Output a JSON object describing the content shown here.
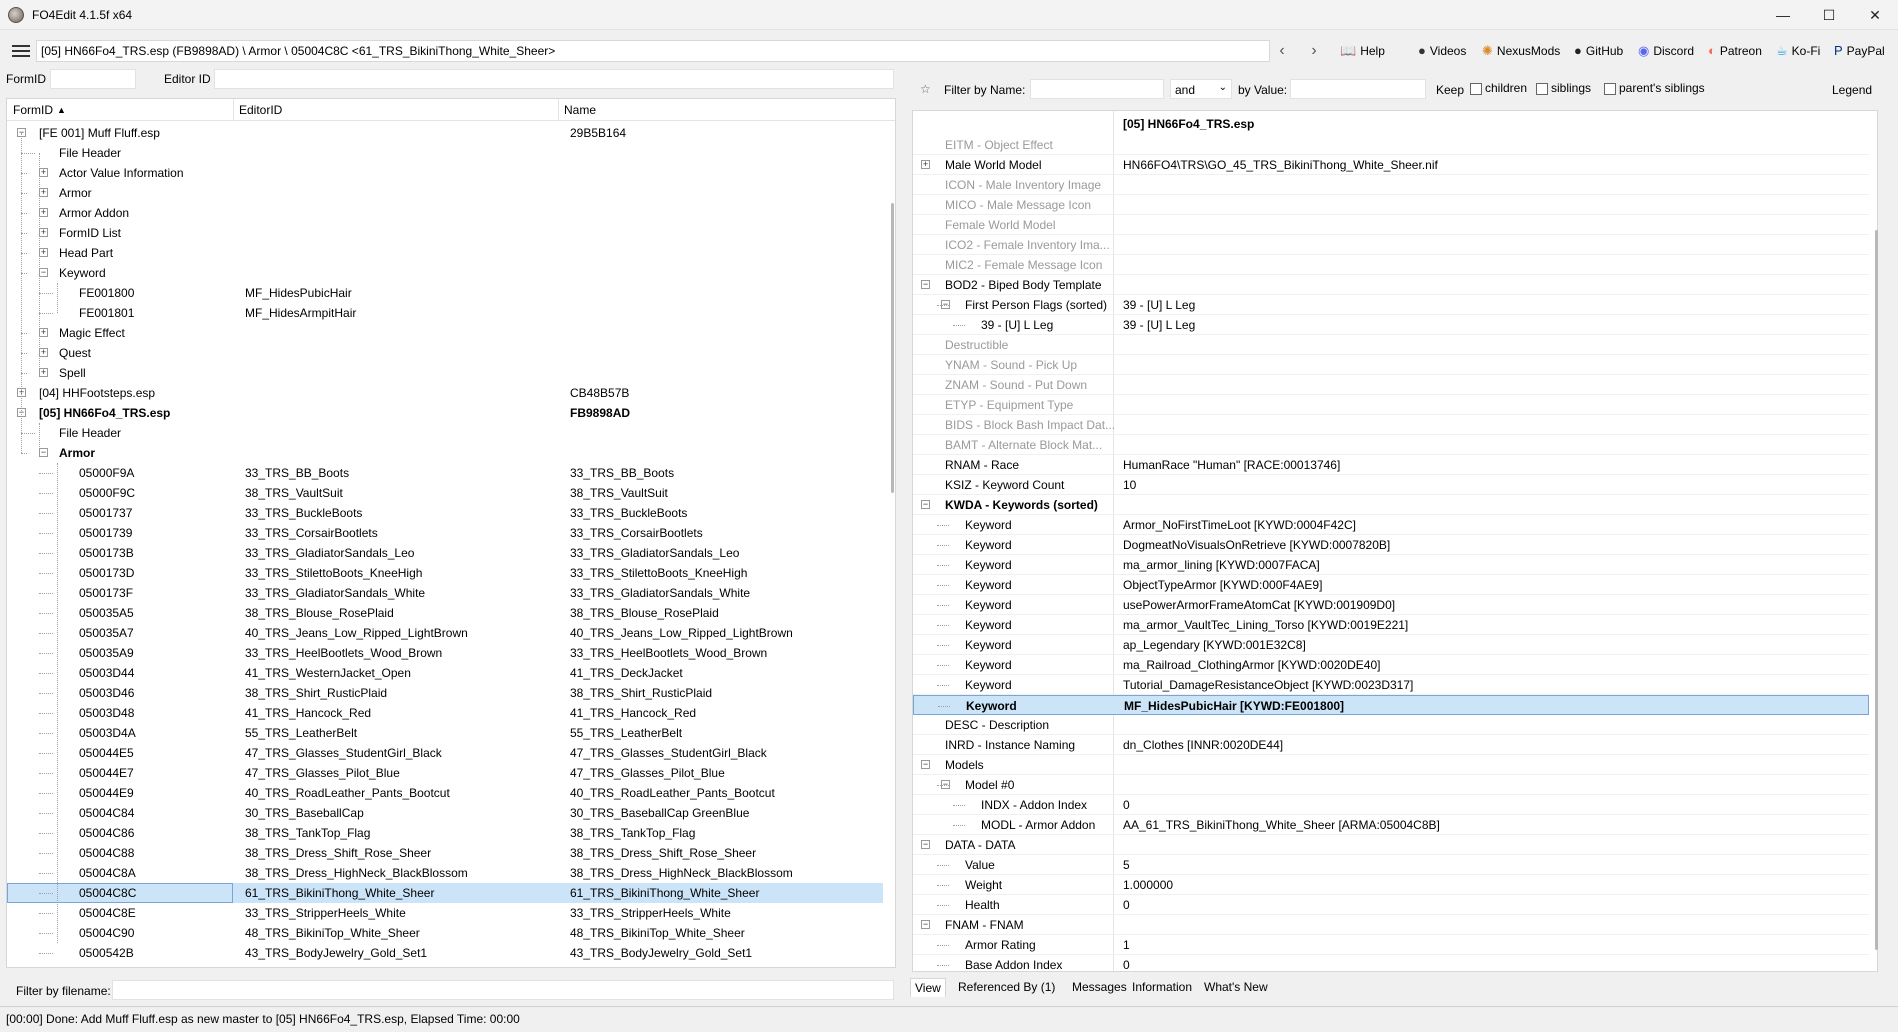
{
  "window": {
    "title": "FO4Edit 4.1.5f x64",
    "minimize": "—",
    "maximize": "☐",
    "close": "✕"
  },
  "pathbar": {
    "path": "[05] HN66Fo4_TRS.esp (FB9898AD) \\ Armor \\ 05004C8C <61_TRS_BikiniThong_White_Sheer>"
  },
  "links": [
    {
      "label": "Help",
      "icon": "book-icon"
    },
    {
      "label": "Videos",
      "icon": "video-icon"
    },
    {
      "label": "NexusMods",
      "icon": "nexus-icon"
    },
    {
      "label": "GitHub",
      "icon": "github-icon"
    },
    {
      "label": "Discord",
      "icon": "discord-icon"
    },
    {
      "label": "Patreon",
      "icon": "patreon-icon"
    },
    {
      "label": "Ko-Fi",
      "icon": "kofi-icon"
    },
    {
      "label": "PayPal",
      "icon": "paypal-icon"
    }
  ],
  "left": {
    "formid_label": "FormID",
    "editorid_label": "Editor ID",
    "columns": [
      "FormID",
      "EditorID",
      "Name"
    ],
    "filter_label": "Filter by filename:",
    "rows": [
      {
        "depth": 0,
        "exp": "−",
        "c1": "[FE 001] Muff Fluff.esp",
        "c2": "",
        "c3": "29B5B164",
        "bold": false
      },
      {
        "depth": 1,
        "exp": "",
        "c1": "File Header",
        "c2": "",
        "c3": ""
      },
      {
        "depth": 1,
        "exp": "+",
        "c1": "Actor Value Information",
        "c2": "",
        "c3": ""
      },
      {
        "depth": 1,
        "exp": "+",
        "c1": "Armor",
        "c2": "",
        "c3": ""
      },
      {
        "depth": 1,
        "exp": "+",
        "c1": "Armor Addon",
        "c2": "",
        "c3": ""
      },
      {
        "depth": 1,
        "exp": "+",
        "c1": "FormID List",
        "c2": "",
        "c3": ""
      },
      {
        "depth": 1,
        "exp": "+",
        "c1": "Head Part",
        "c2": "",
        "c3": ""
      },
      {
        "depth": 1,
        "exp": "−",
        "c1": "Keyword",
        "c2": "",
        "c3": ""
      },
      {
        "depth": 2,
        "exp": "",
        "c1": "FE001800",
        "c2": "MF_HidesPubicHair",
        "c3": ""
      },
      {
        "depth": 2,
        "exp": "",
        "c1": "FE001801",
        "c2": "MF_HidesArmpitHair",
        "c3": ""
      },
      {
        "depth": 1,
        "exp": "+",
        "c1": "Magic Effect",
        "c2": "",
        "c3": ""
      },
      {
        "depth": 1,
        "exp": "+",
        "c1": "Quest",
        "c2": "",
        "c3": ""
      },
      {
        "depth": 1,
        "exp": "+",
        "c1": "Spell",
        "c2": "",
        "c3": ""
      },
      {
        "depth": 0,
        "exp": "+",
        "c1": "[04] HHFootsteps.esp",
        "c2": "",
        "c3": "CB48B57B"
      },
      {
        "depth": 0,
        "exp": "−",
        "c1": "[05] HN66Fo4_TRS.esp",
        "c2": "",
        "c3": "FB9898AD",
        "bold": true
      },
      {
        "depth": 1,
        "exp": "",
        "c1": "File Header",
        "c2": "",
        "c3": ""
      },
      {
        "depth": 1,
        "exp": "−",
        "c1": "Armor",
        "c2": "",
        "c3": "",
        "bold": true
      },
      {
        "depth": 2,
        "exp": "",
        "c1": "05000F9A",
        "c2": "33_TRS_BB_Boots",
        "c3": "33_TRS_BB_Boots"
      },
      {
        "depth": 2,
        "exp": "",
        "c1": "05000F9C",
        "c2": "38_TRS_VaultSuit",
        "c3": "38_TRS_VaultSuit"
      },
      {
        "depth": 2,
        "exp": "",
        "c1": "05001737",
        "c2": "33_TRS_BuckleBoots",
        "c3": "33_TRS_BuckleBoots"
      },
      {
        "depth": 2,
        "exp": "",
        "c1": "05001739",
        "c2": "33_TRS_CorsairBootlets",
        "c3": "33_TRS_CorsairBootlets"
      },
      {
        "depth": 2,
        "exp": "",
        "c1": "0500173B",
        "c2": "33_TRS_GladiatorSandals_Leo",
        "c3": "33_TRS_GladiatorSandals_Leo"
      },
      {
        "depth": 2,
        "exp": "",
        "c1": "0500173D",
        "c2": "33_TRS_StilettoBoots_KneeHigh",
        "c3": "33_TRS_StilettoBoots_KneeHigh"
      },
      {
        "depth": 2,
        "exp": "",
        "c1": "0500173F",
        "c2": "33_TRS_GladiatorSandals_White",
        "c3": "33_TRS_GladiatorSandals_White"
      },
      {
        "depth": 2,
        "exp": "",
        "c1": "050035A5",
        "c2": "38_TRS_Blouse_RosePlaid",
        "c3": "38_TRS_Blouse_RosePlaid"
      },
      {
        "depth": 2,
        "exp": "",
        "c1": "050035A7",
        "c2": "40_TRS_Jeans_Low_Ripped_LightBrown",
        "c3": "40_TRS_Jeans_Low_Ripped_LightBrown"
      },
      {
        "depth": 2,
        "exp": "",
        "c1": "050035A9",
        "c2": "33_TRS_HeelBootlets_Wood_Brown",
        "c3": "33_TRS_HeelBootlets_Wood_Brown"
      },
      {
        "depth": 2,
        "exp": "",
        "c1": "05003D44",
        "c2": "41_TRS_WesternJacket_Open",
        "c3": "41_TRS_DeckJacket"
      },
      {
        "depth": 2,
        "exp": "",
        "c1": "05003D46",
        "c2": "38_TRS_Shirt_RusticPlaid",
        "c3": "38_TRS_Shirt_RusticPlaid"
      },
      {
        "depth": 2,
        "exp": "",
        "c1": "05003D48",
        "c2": "41_TRS_Hancock_Red",
        "c3": "41_TRS_Hancock_Red"
      },
      {
        "depth": 2,
        "exp": "",
        "c1": "05003D4A",
        "c2": "55_TRS_LeatherBelt",
        "c3": "55_TRS_LeatherBelt"
      },
      {
        "depth": 2,
        "exp": "",
        "c1": "050044E5",
        "c2": "47_TRS_Glasses_StudentGirl_Black",
        "c3": "47_TRS_Glasses_StudentGirl_Black"
      },
      {
        "depth": 2,
        "exp": "",
        "c1": "050044E7",
        "c2": "47_TRS_Glasses_Pilot_Blue",
        "c3": "47_TRS_Glasses_Pilot_Blue"
      },
      {
        "depth": 2,
        "exp": "",
        "c1": "050044E9",
        "c2": "40_TRS_RoadLeather_Pants_Bootcut",
        "c3": "40_TRS_RoadLeather_Pants_Bootcut"
      },
      {
        "depth": 2,
        "exp": "",
        "c1": "05004C84",
        "c2": "30_TRS_BaseballCap",
        "c3": "30_TRS_BaseballCap GreenBlue"
      },
      {
        "depth": 2,
        "exp": "",
        "c1": "05004C86",
        "c2": "38_TRS_TankTop_Flag",
        "c3": "38_TRS_TankTop_Flag"
      },
      {
        "depth": 2,
        "exp": "",
        "c1": "05004C88",
        "c2": "38_TRS_Dress_Shift_Rose_Sheer",
        "c3": "38_TRS_Dress_Shift_Rose_Sheer"
      },
      {
        "depth": 2,
        "exp": "",
        "c1": "05004C8A",
        "c2": "38_TRS_Dress_HighNeck_BlackBlossom",
        "c3": "38_TRS_Dress_HighNeck_BlackBlossom"
      },
      {
        "depth": 2,
        "exp": "",
        "c1": "05004C8C",
        "c2": "61_TRS_BikiniThong_White_Sheer",
        "c3": "61_TRS_BikiniThong_White_Sheer",
        "selected": true
      },
      {
        "depth": 2,
        "exp": "",
        "c1": "05004C8E",
        "c2": "33_TRS_StripperHeels_White",
        "c3": "33_TRS_StripperHeels_White"
      },
      {
        "depth": 2,
        "exp": "",
        "c1": "05004C90",
        "c2": "48_TRS_BikiniTop_White_Sheer",
        "c3": "48_TRS_BikiniTop_White_Sheer"
      },
      {
        "depth": 2,
        "exp": "",
        "c1": "0500542B",
        "c2": "43_TRS_BodyJewelry_Gold_Set1",
        "c3": "43_TRS_BodyJewelry_Gold_Set1"
      }
    ]
  },
  "right": {
    "filter_name_label": "Filter by Name:",
    "and_label": "and",
    "by_value_label": "by Value:",
    "keep_label": "Keep",
    "children_label": "children",
    "siblings_label": "siblings",
    "parents_label": "parent's siblings",
    "legend_label": "Legend",
    "header_value": "[05] HN66Fo4_TRS.esp",
    "rows": [
      {
        "ind": 0,
        "exp": "",
        "nm": "EITM - Object Effect",
        "val": "",
        "dim": true
      },
      {
        "ind": 0,
        "exp": "+",
        "nm": "Male World Model",
        "val": "HN66FO4\\TRS\\GO_45_TRS_BikiniThong_White_Sheer.nif"
      },
      {
        "ind": 0,
        "exp": "",
        "nm": "ICON - Male Inventory Image",
        "val": "",
        "dim": true
      },
      {
        "ind": 0,
        "exp": "",
        "nm": "MICO - Male Message Icon",
        "val": "",
        "dim": true
      },
      {
        "ind": 0,
        "exp": "",
        "nm": "Female World Model",
        "val": "",
        "dim": true
      },
      {
        "ind": 0,
        "exp": "",
        "nm": "ICO2 - Female Inventory Ima...",
        "val": "",
        "dim": true
      },
      {
        "ind": 0,
        "exp": "",
        "nm": "MIC2 - Female Message Icon",
        "val": "",
        "dim": true
      },
      {
        "ind": 0,
        "exp": "−",
        "nm": "BOD2 - Biped Body Template",
        "val": ""
      },
      {
        "ind": 1,
        "exp": "−",
        "nm": "First Person Flags (sorted)",
        "val": "39 - [U] L Leg"
      },
      {
        "ind": 2,
        "exp": "",
        "nm": "39 - [U] L Leg",
        "val": "39 - [U] L Leg"
      },
      {
        "ind": 0,
        "exp": "",
        "nm": "Destructible",
        "val": "",
        "dim": true
      },
      {
        "ind": 0,
        "exp": "",
        "nm": "YNAM - Sound - Pick Up",
        "val": "",
        "dim": true
      },
      {
        "ind": 0,
        "exp": "",
        "nm": "ZNAM - Sound - Put Down",
        "val": "",
        "dim": true
      },
      {
        "ind": 0,
        "exp": "",
        "nm": "ETYP - Equipment Type",
        "val": "",
        "dim": true
      },
      {
        "ind": 0,
        "exp": "",
        "nm": "BIDS - Block Bash Impact Dat...",
        "val": "",
        "dim": true
      },
      {
        "ind": 0,
        "exp": "",
        "nm": "BAMT - Alternate Block Mat...",
        "val": "",
        "dim": true
      },
      {
        "ind": 0,
        "exp": "",
        "nm": "RNAM - Race",
        "val": "HumanRace \"Human\" [RACE:00013746]"
      },
      {
        "ind": 0,
        "exp": "",
        "nm": "KSIZ - Keyword Count",
        "val": "10"
      },
      {
        "ind": 0,
        "exp": "−",
        "nm": "KWDA - Keywords (sorted)",
        "val": "",
        "bold": true
      },
      {
        "ind": 1,
        "exp": "",
        "nm": "Keyword",
        "val": "Armor_NoFirstTimeLoot [KYWD:0004F42C]"
      },
      {
        "ind": 1,
        "exp": "",
        "nm": "Keyword",
        "val": "DogmeatNoVisualsOnRetrieve [KYWD:0007820B]"
      },
      {
        "ind": 1,
        "exp": "",
        "nm": "Keyword",
        "val": "ma_armor_lining [KYWD:0007FACA]"
      },
      {
        "ind": 1,
        "exp": "",
        "nm": "Keyword",
        "val": "ObjectTypeArmor [KYWD:000F4AE9]"
      },
      {
        "ind": 1,
        "exp": "",
        "nm": "Keyword",
        "val": "usePowerArmorFrameAtomCat [KYWD:001909D0]"
      },
      {
        "ind": 1,
        "exp": "",
        "nm": "Keyword",
        "val": "ma_armor_VaultTec_Lining_Torso [KYWD:0019E221]"
      },
      {
        "ind": 1,
        "exp": "",
        "nm": "Keyword",
        "val": "ap_Legendary [KYWD:001E32C8]"
      },
      {
        "ind": 1,
        "exp": "",
        "nm": "Keyword",
        "val": "ma_Railroad_ClothingArmor [KYWD:0020DE40]"
      },
      {
        "ind": 1,
        "exp": "",
        "nm": "Keyword",
        "val": "Tutorial_DamageResistanceObject [KYWD:0023D317]"
      },
      {
        "ind": 1,
        "exp": "",
        "nm": "Keyword",
        "val": "MF_HidesPubicHair [KYWD:FE001800]",
        "selected": true
      },
      {
        "ind": 0,
        "exp": "",
        "nm": "DESC - Description",
        "val": ""
      },
      {
        "ind": 0,
        "exp": "",
        "nm": "INRD - Instance Naming",
        "val": "dn_Clothes [INNR:0020DE44]"
      },
      {
        "ind": 0,
        "exp": "−",
        "nm": "Models",
        "val": ""
      },
      {
        "ind": 1,
        "exp": "−",
        "nm": "Model #0",
        "val": ""
      },
      {
        "ind": 2,
        "exp": "",
        "nm": "INDX - Addon Index",
        "val": "0"
      },
      {
        "ind": 2,
        "exp": "",
        "nm": "MODL - Armor Addon",
        "val": "AA_61_TRS_BikiniThong_White_Sheer [ARMA:05004C8B]"
      },
      {
        "ind": 0,
        "exp": "−",
        "nm": "DATA - DATA",
        "val": ""
      },
      {
        "ind": 1,
        "exp": "",
        "nm": "Value",
        "val": "5"
      },
      {
        "ind": 1,
        "exp": "",
        "nm": "Weight",
        "val": "1.000000"
      },
      {
        "ind": 1,
        "exp": "",
        "nm": "Health",
        "val": "0"
      },
      {
        "ind": 0,
        "exp": "−",
        "nm": "FNAM - FNAM",
        "val": ""
      },
      {
        "ind": 1,
        "exp": "",
        "nm": "Armor Rating",
        "val": "1"
      },
      {
        "ind": 1,
        "exp": "",
        "nm": "Base Addon Index",
        "val": "0"
      }
    ],
    "tabs": [
      "View",
      "Referenced By (1)",
      "Messages",
      "Information",
      "What's New"
    ]
  },
  "status": {
    "text": "[00:00] Done: Add Muff Fluff.esp as new master to [05] HN66Fo4_TRS.esp, Elapsed Time: 00:00"
  },
  "colors": {
    "selection": "#cce4f7",
    "dim_text": "#9a9a9a"
  }
}
